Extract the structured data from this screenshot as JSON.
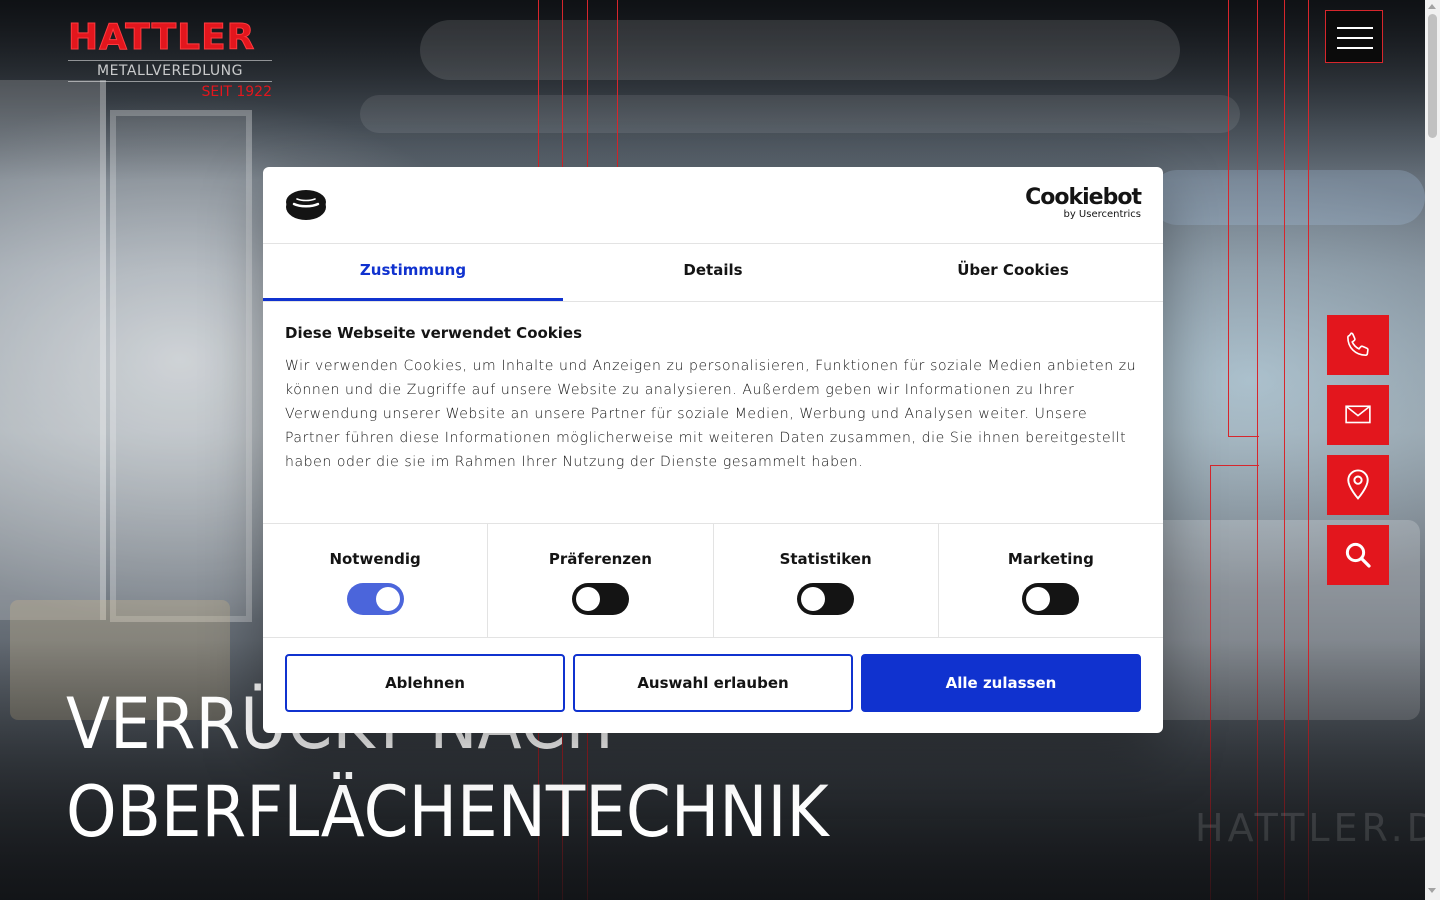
{
  "brand": {
    "logo_word": "HATTLER",
    "logo_sub": "METALLVEREDLUNG",
    "logo_since": "SEIT 1922",
    "accent_color": "#e3161d"
  },
  "hero": {
    "title_line1": "VERRÜCKT NACH",
    "title_line2": "OBERFLÄCHENTECHNIK",
    "watermark": "HATTLER.DE"
  },
  "side_actions": [
    {
      "icon": "phone-icon"
    },
    {
      "icon": "mail-icon"
    },
    {
      "icon": "location-pin-icon"
    },
    {
      "icon": "search-icon"
    }
  ],
  "cookie_dialog": {
    "brand_name": "Cookiebot",
    "brand_by": "by Usercentrics",
    "accent_color": "#1032cf",
    "tabs": [
      {
        "label": "Zustimmung",
        "active": true
      },
      {
        "label": "Details",
        "active": false
      },
      {
        "label": "Über Cookies",
        "active": false
      }
    ],
    "heading": "Diese Webseite verwendet Cookies",
    "body": "Wir verwenden Cookies, um Inhalte und Anzeigen zu personalisieren, Funktionen für soziale Medien anbieten zu können und die Zugriffe auf unsere Website zu analysieren. Außerdem geben wir Informationen zu Ihrer Verwendung unserer Website an unsere Partner für soziale Medien, Werbung und Analysen weiter. Unsere Partner führen diese Informationen möglicherweise mit weiteren Daten zusammen, die Sie ihnen bereitgestellt haben oder die sie im Rahmen Ihrer Nutzung der Dienste gesammelt haben.",
    "categories": [
      {
        "label": "Notwendig",
        "enabled": true
      },
      {
        "label": "Präferenzen",
        "enabled": false
      },
      {
        "label": "Statistiken",
        "enabled": false
      },
      {
        "label": "Marketing",
        "enabled": false
      }
    ],
    "buttons": {
      "decline": "Ablehnen",
      "allow_selection": "Auswahl erlauben",
      "allow_all": "Alle zulassen"
    }
  }
}
